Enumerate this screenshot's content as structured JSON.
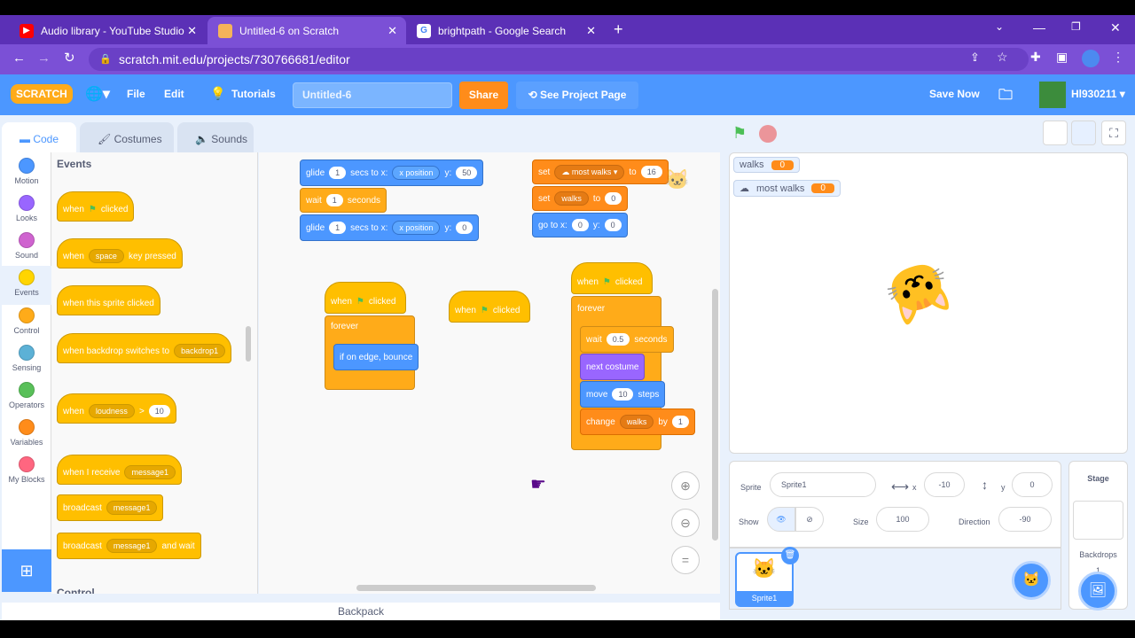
{
  "browser": {
    "tabs": [
      {
        "label": "Audio library - YouTube Studio"
      },
      {
        "label": "Untitled-6 on Scratch"
      },
      {
        "label": "brightpath - Google Search"
      }
    ],
    "url": "scratch.mit.edu/projects/730766681/editor",
    "new_tab": "+"
  },
  "menu": {
    "logo": "SCRATCH",
    "file": "File",
    "edit": "Edit",
    "tutorials": "Tutorials",
    "project_title": "Untitled-6",
    "share": "Share",
    "see_project": "See Project Page",
    "save_now": "Save Now",
    "username": "Hl930211"
  },
  "editor_tabs": {
    "code": "Code",
    "costumes": "Costumes",
    "sounds": "Sounds"
  },
  "categories": [
    {
      "label": "Motion",
      "color": "#4c97ff"
    },
    {
      "label": "Looks",
      "color": "#9966ff"
    },
    {
      "label": "Sound",
      "color": "#cf63cf"
    },
    {
      "label": "Events",
      "color": "#ffd500"
    },
    {
      "label": "Control",
      "color": "#ffab19"
    },
    {
      "label": "Sensing",
      "color": "#5cb1d6"
    },
    {
      "label": "Operators",
      "color": "#59c059"
    },
    {
      "label": "Variables",
      "color": "#ff8c1a"
    },
    {
      "label": "My Blocks",
      "color": "#ff6680"
    }
  ],
  "palette": {
    "heading": "Events",
    "next_heading": "Control",
    "blocks": {
      "when": "when",
      "clicked": "clicked",
      "space": "space",
      "key_pressed": "key pressed",
      "when_sprite_clicked": "when this sprite clicked",
      "when_backdrop": "when backdrop switches to",
      "backdrop1": "backdrop1",
      "loudness": "loudness",
      "gt": ">",
      "ten": "10",
      "when_receive": "when I receive",
      "message1": "message1",
      "broadcast": "broadcast",
      "and_wait": "and wait"
    }
  },
  "scripts": {
    "glide": "glide",
    "secs_to_x": "secs to x:",
    "x_position": "x position",
    "y": "y:",
    "one": "1",
    "fifty": "50",
    "zero": "0",
    "wait": "wait",
    "seconds": "seconds",
    "set": "set",
    "most_walks": "most walks",
    "to": "to",
    "sixteen": "16",
    "walks": "walks",
    "go_to_x": "go to x:",
    "when": "when",
    "clicked": "clicked",
    "forever": "forever",
    "bounce": "if on edge, bounce",
    "half": "0.5",
    "next_costume": "next costume",
    "move": "move",
    "ten": "10",
    "steps": "steps",
    "change": "change",
    "by": "by"
  },
  "zoom": {
    "equal": "="
  },
  "backpack": "Backpack",
  "stage": {
    "monitors": [
      {
        "label": "walks",
        "value": "0"
      },
      {
        "label": "most walks",
        "value": "0"
      }
    ]
  },
  "sprite_info": {
    "sprite_label": "Sprite",
    "sprite_name": "Sprite1",
    "x_label": "x",
    "x": "-10",
    "y_label": "y",
    "y": "0",
    "show_label": "Show",
    "size_label": "Size",
    "size": "100",
    "direction_label": "Direction",
    "direction": "-90"
  },
  "sprites": [
    {
      "name": "Sprite1"
    }
  ],
  "stage_selector": {
    "title": "Stage",
    "backdrops_label": "Backdrops",
    "backdrops_count": "1"
  }
}
